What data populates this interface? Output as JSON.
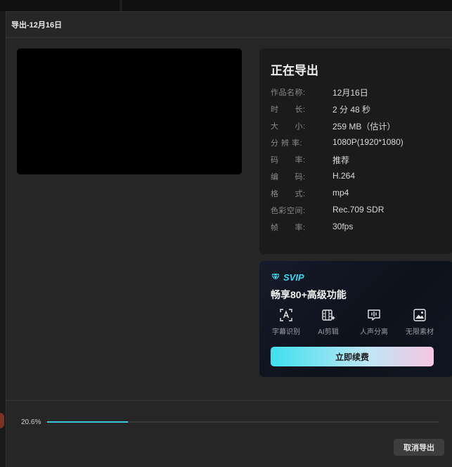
{
  "dialog": {
    "title": "导出-12月16日"
  },
  "info": {
    "heading": "正在导出",
    "rows": [
      {
        "label": "作品名称:",
        "value": "12月16日"
      },
      {
        "label": "时　　长:",
        "value": "2 分 48 秒"
      },
      {
        "label": "大　　小:",
        "value": "259 MB（估计）"
      },
      {
        "label": "分 辨 率:",
        "value": "1080P(1920*1080)"
      },
      {
        "label": "码　　率:",
        "value": "推荐"
      },
      {
        "label": "编　　码:",
        "value": "H.264"
      },
      {
        "label": "格　　式:",
        "value": "mp4"
      },
      {
        "label": "色彩空间:",
        "value": "Rec.709 SDR"
      },
      {
        "label": "帧　　率:",
        "value": "30fps"
      }
    ]
  },
  "vip": {
    "badge": "SVIP",
    "title": "畅享80+高级功能",
    "features": [
      {
        "label": "字幕识别",
        "icon": "subtitle-recognition-icon"
      },
      {
        "label": "AI剪辑",
        "icon": "ai-edit-icon"
      },
      {
        "label": "人声分离",
        "icon": "voice-separation-icon"
      },
      {
        "label": "无限素材",
        "icon": "unlimited-assets-icon"
      }
    ],
    "renew_label": "立即续费"
  },
  "progress": {
    "label": "20.6%",
    "fraction": 0.206
  },
  "footer": {
    "cancel_label": "取消导出"
  },
  "colors": {
    "accent": "#3cc8df",
    "vip_badge": "#38d7f0"
  }
}
